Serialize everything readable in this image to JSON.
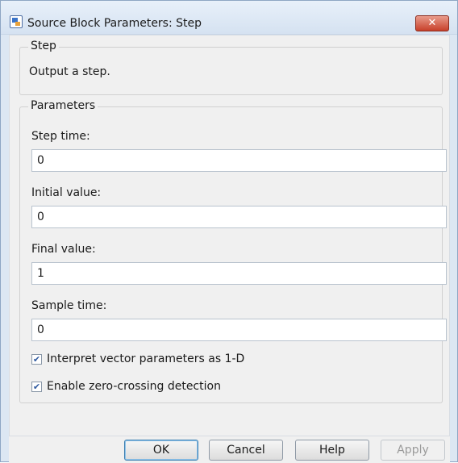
{
  "window": {
    "title": "Source Block Parameters: Step",
    "close_label": "✕"
  },
  "step_group": {
    "legend": "Step",
    "description": "Output a step."
  },
  "params_group": {
    "legend": "Parameters",
    "fields": [
      {
        "label": "Step time:",
        "value": "0"
      },
      {
        "label": "Initial value:",
        "value": "0"
      },
      {
        "label": "Final value:",
        "value": "1"
      },
      {
        "label": "Sample time:",
        "value": "0"
      }
    ],
    "checkboxes": [
      {
        "label": "Interpret vector parameters as 1-D",
        "checked": true
      },
      {
        "label": "Enable zero-crossing detection",
        "checked": true
      }
    ]
  },
  "buttons": {
    "ok": "OK",
    "cancel": "Cancel",
    "help": "Help",
    "apply": "Apply"
  },
  "colors": {
    "close_button": "#c7402a",
    "title_bar": "#dce7f3",
    "checkmark": "#2f5aa0"
  }
}
